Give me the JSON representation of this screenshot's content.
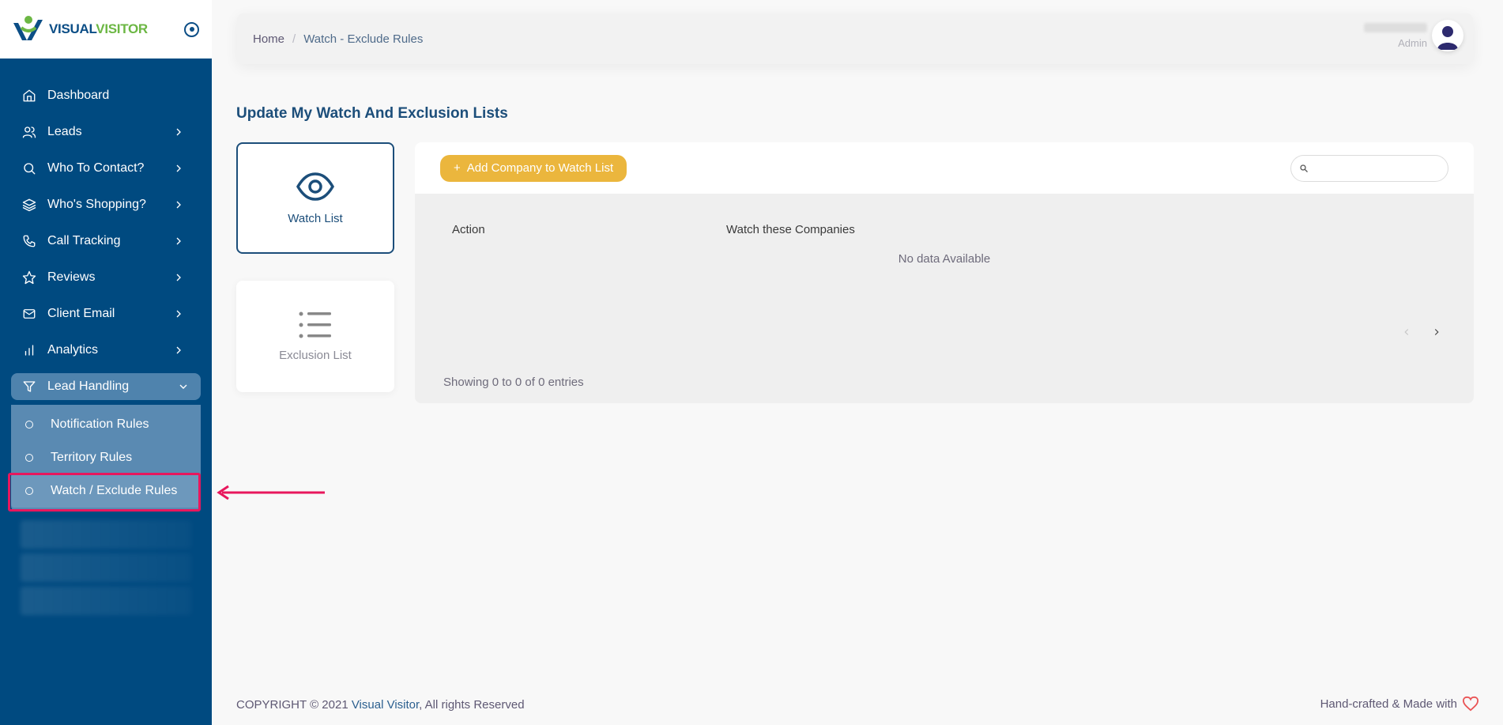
{
  "brand": {
    "part1": "VISUAL",
    "part2": "VISITOR"
  },
  "sidebar": {
    "items": [
      {
        "label": "Dashboard",
        "icon": "home-icon"
      },
      {
        "label": "Leads",
        "icon": "users-icon"
      },
      {
        "label": "Who To Contact?",
        "icon": "search-icon"
      },
      {
        "label": "Who's Shopping?",
        "icon": "layers-icon"
      },
      {
        "label": "Call Tracking",
        "icon": "phone-icon"
      },
      {
        "label": "Reviews",
        "icon": "star-icon"
      },
      {
        "label": "Client Email",
        "icon": "mail-icon"
      },
      {
        "label": "Analytics",
        "icon": "bar-chart-icon"
      },
      {
        "label": "Lead Handling",
        "icon": "filter-icon"
      }
    ],
    "submenu": [
      {
        "label": "Notification Rules"
      },
      {
        "label": "Territory Rules"
      },
      {
        "label": "Watch / Exclude Rules"
      }
    ]
  },
  "header": {
    "breadcrumb_home": "Home",
    "breadcrumb_sep": "/",
    "breadcrumb_current": "Watch - Exclude Rules",
    "user_role": "Admin"
  },
  "page": {
    "title": "Update My Watch And Exclusion Lists",
    "tabs": [
      {
        "label": "Watch List"
      },
      {
        "label": "Exclusion List"
      }
    ]
  },
  "panel": {
    "add_button": "Add Company to Watch List",
    "add_button_prefix": "+",
    "search_placeholder": "",
    "columns": [
      "Action",
      "Watch these Companies"
    ],
    "empty_text": "No data Available",
    "info_text": "Showing 0 to 0 of 0 entries"
  },
  "footer": {
    "copyright_prefix": "COPYRIGHT © 2021 ",
    "copyright_brand": "Visual Visitor",
    "copyright_suffix": ", All rights Reserved",
    "made_with": "Hand-crafted & Made with"
  },
  "colors": {
    "sidebar_bg": "#004a80",
    "accent": "#1c4e7a",
    "button": "#ebb63d",
    "highlight": "#e8175d"
  }
}
